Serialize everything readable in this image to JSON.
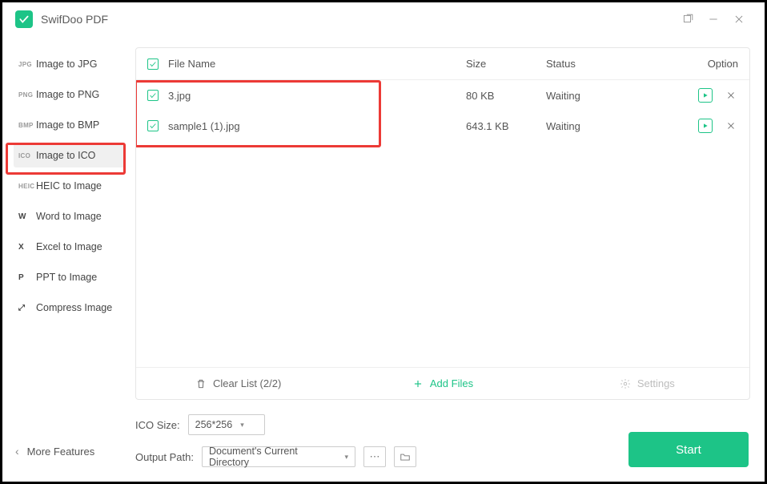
{
  "app_title": "SwifDoo PDF",
  "sidebar": {
    "items": [
      {
        "badge": "JPG",
        "label": "Image to JPG"
      },
      {
        "badge": "PNG",
        "label": "Image to PNG"
      },
      {
        "badge": "BMP",
        "label": "Image to BMP"
      },
      {
        "badge": "ICO",
        "label": "Image to ICO"
      },
      {
        "badge": "HEIC",
        "label": "HEIC to Image"
      },
      {
        "badge": "W",
        "label": "Word to Image"
      },
      {
        "badge": "X",
        "label": "Excel to Image"
      },
      {
        "badge": "P",
        "label": "PPT to Image"
      },
      {
        "badge": "⤢",
        "label": "Compress Image"
      }
    ],
    "selected_index": 3,
    "more_features": "More Features"
  },
  "table": {
    "headers": {
      "name": "File Name",
      "size": "Size",
      "status": "Status",
      "option": "Option"
    },
    "rows": [
      {
        "name": "3.jpg",
        "size": "80 KB",
        "status": "Waiting"
      },
      {
        "name": "sample1 (1).jpg",
        "size": "643.1 KB",
        "status": "Waiting"
      }
    ]
  },
  "actions": {
    "clear": "Clear List (2/2)",
    "add": "Add Files",
    "settings": "Settings"
  },
  "options": {
    "ico_size_label": "ICO Size:",
    "ico_size_value": "256*256",
    "output_path_label": "Output Path:",
    "output_path_value": "Document's Current Directory"
  },
  "start_label": "Start",
  "highlight_colors": {
    "red": "#ec3a36",
    "accent": "#1dc487"
  }
}
